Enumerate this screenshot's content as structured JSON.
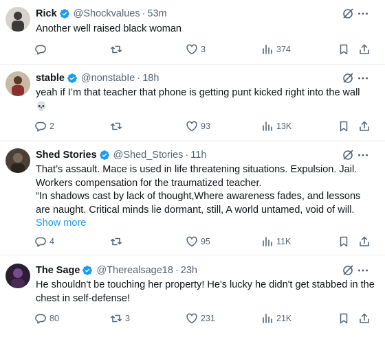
{
  "tweets": [
    {
      "name": "Rick",
      "handle": "@Shockvalues",
      "sep": "·",
      "time": "53m",
      "text": "Another well raised black woman",
      "show_more": "",
      "replies": "",
      "retweets": "",
      "likes": "3",
      "views": "374",
      "avatar_colors": [
        "#d7d3cc",
        "#3a3a3a"
      ]
    },
    {
      "name": "stable",
      "handle": "@nonstabIe",
      "sep": "·",
      "time": "18h",
      "text": "yeah if I’m that teacher that phone is getting punt kicked right into the wall",
      "emoji": "💀",
      "show_more": "",
      "replies": "2",
      "retweets": "",
      "likes": "93",
      "views": "13K",
      "avatar_colors": [
        "#c9b9a6",
        "#8a2f2f"
      ]
    },
    {
      "name": "Shed Stories",
      "handle": "@Shed_Stories",
      "sep": "·",
      "time": "11h",
      "text": "That’s assault. Mace is used in life threatening situations. Expulsion. Jail. Workers compensation for the traumatized teacher.\n“In shadows cast by lack of thought,Where awareness fades, and lessons are naught.  Critical minds lie dormant, still,  A world untamed, void of will.",
      "show_more": "Show more",
      "replies": "4",
      "retweets": "",
      "likes": "95",
      "views": "11K",
      "avatar_colors": [
        "#4a4036",
        "#2a2420"
      ]
    },
    {
      "name": "The Sage",
      "handle": "@Therealsage18",
      "sep": "·",
      "time": "23h",
      "text": "He shouldn't be touching her property! He's lucky he didn't get stabbed in the chest in self-defense!",
      "show_more": "",
      "replies": "80",
      "retweets": "3",
      "likes": "231",
      "views": "21K",
      "avatar_colors": [
        "#2b1e33",
        "#7a4a8f"
      ]
    }
  ],
  "colors": {
    "verified": "#1d9bf0",
    "secondary_text": "#536471",
    "link": "#1d9bf0",
    "divider": "#e7e9eb"
  },
  "icons": {
    "reply": "reply-icon",
    "retweet": "retweet-icon",
    "like": "heart-icon",
    "views": "views-icon",
    "bookmark": "bookmark-icon",
    "share": "share-icon",
    "grok": "grok-icon",
    "more": "more-icon",
    "verified": "verified-badge-icon"
  }
}
